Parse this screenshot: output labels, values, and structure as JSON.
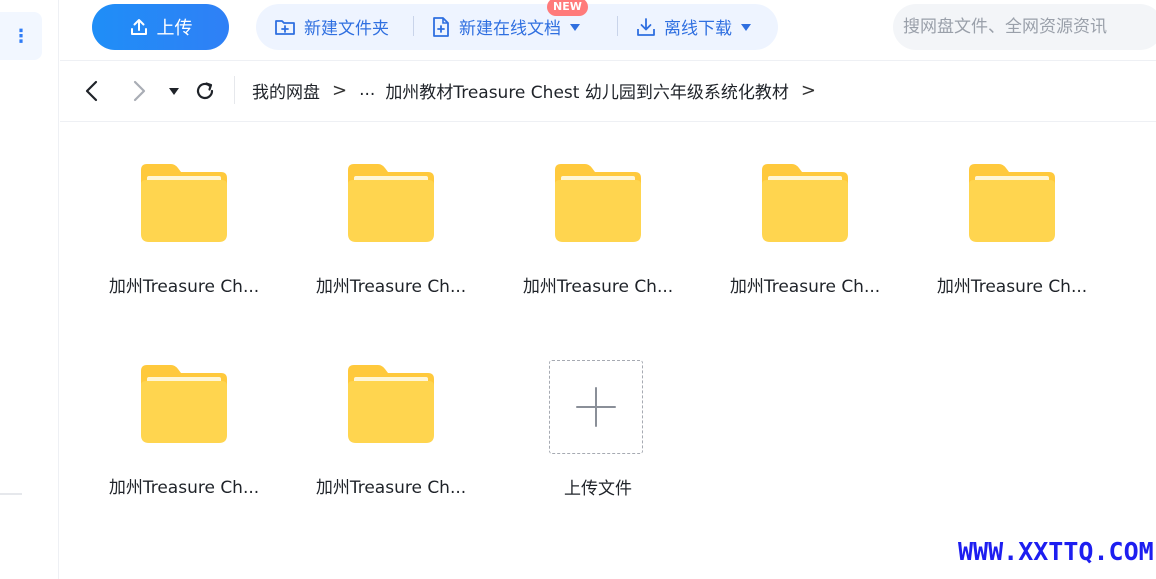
{
  "toolbar": {
    "upload_label": "上传",
    "new_folder_label": "新建文件夹",
    "new_doc_label": "新建在线文档",
    "new_badge": "NEW",
    "offline_download_label": "离线下载"
  },
  "search": {
    "placeholder": "搜网盘文件、全网资源资讯"
  },
  "breadcrumb": {
    "root": "我的网盘",
    "ellipsis": "...",
    "current": "加州教材Treasure Chest 幼儿园到六年级系统化教材"
  },
  "files": [
    {
      "name": "加州Treasure Ch..."
    },
    {
      "name": "加州Treasure Ch..."
    },
    {
      "name": "加州Treasure Ch..."
    },
    {
      "name": "加州Treasure Ch..."
    },
    {
      "name": "加州Treasure Ch..."
    },
    {
      "name": "加州Treasure Ch..."
    },
    {
      "name": "加州Treasure Ch..."
    }
  ],
  "upload_tile": {
    "label": "上传文件"
  },
  "watermark": "WWW.XXTTQ.COM",
  "colors": {
    "accent": "#2f80f6",
    "folder_top": "#ffc93c",
    "folder_front": "#ffd54f",
    "badge": "#ff7a7a",
    "watermark": "#1d1ef0"
  },
  "icons": {
    "upload": "upload-icon",
    "new_folder": "folder-plus-icon",
    "new_doc": "document-plus-icon",
    "download": "download-icon",
    "back": "chevron-left-icon",
    "forward": "chevron-right-icon",
    "dropdown": "caret-down-icon",
    "refresh": "refresh-icon",
    "add": "plus-icon"
  }
}
